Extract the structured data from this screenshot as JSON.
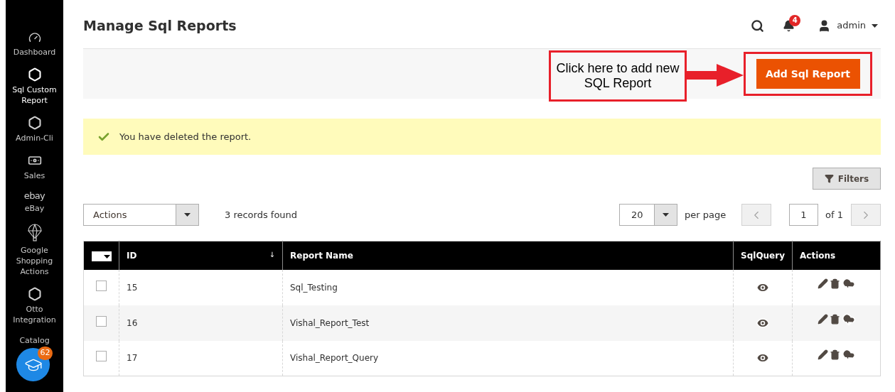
{
  "sidebar": {
    "items": [
      {
        "kind": "gauge",
        "label": "Dashboard",
        "selected": false
      },
      {
        "kind": "hexagon",
        "label": "Sql Custom Report",
        "selected": true
      },
      {
        "kind": "hexagon",
        "label": "Admin-Cli",
        "selected": false
      },
      {
        "kind": "money",
        "label": "Sales",
        "selected": false
      },
      {
        "kind": "logo",
        "logo_text": "ebay",
        "label": "eBay",
        "selected": false
      },
      {
        "kind": "parachute",
        "label": "Google Shopping Actions",
        "selected": false
      },
      {
        "kind": "hexagon",
        "label": "Otto Integration",
        "selected": false
      },
      {
        "kind": "none",
        "label": "Catalog",
        "selected": false
      }
    ],
    "floating_button": {
      "badge": "62"
    }
  },
  "header": {
    "title": "Manage Sql Reports",
    "notifications": "4",
    "user": "admin"
  },
  "action_bar": {
    "callout": "Click here to add new SQL Report",
    "button": "Add Sql Report"
  },
  "message": "You have deleted the report.",
  "filters_button": "Filters",
  "toolbar": {
    "actions": "Actions",
    "records": "3 records found",
    "per_page_value": "20",
    "per_page_label": "per page",
    "page": "1",
    "of_pages": "of 1",
    "prev_disabled": true,
    "next_disabled": true
  },
  "table": {
    "columns": [
      {
        "label": "ID",
        "sort": "↓"
      },
      {
        "label": "Report Name"
      },
      {
        "label": "SqlQuery"
      },
      {
        "label": "Actions"
      }
    ],
    "rows": [
      {
        "checked": false,
        "id": "15",
        "name": "Sql_Testing"
      },
      {
        "checked": false,
        "id": "16",
        "name": "Vishal_Report_Test"
      },
      {
        "checked": false,
        "id": "17",
        "name": "Vishal_Report_Query"
      }
    ]
  }
}
